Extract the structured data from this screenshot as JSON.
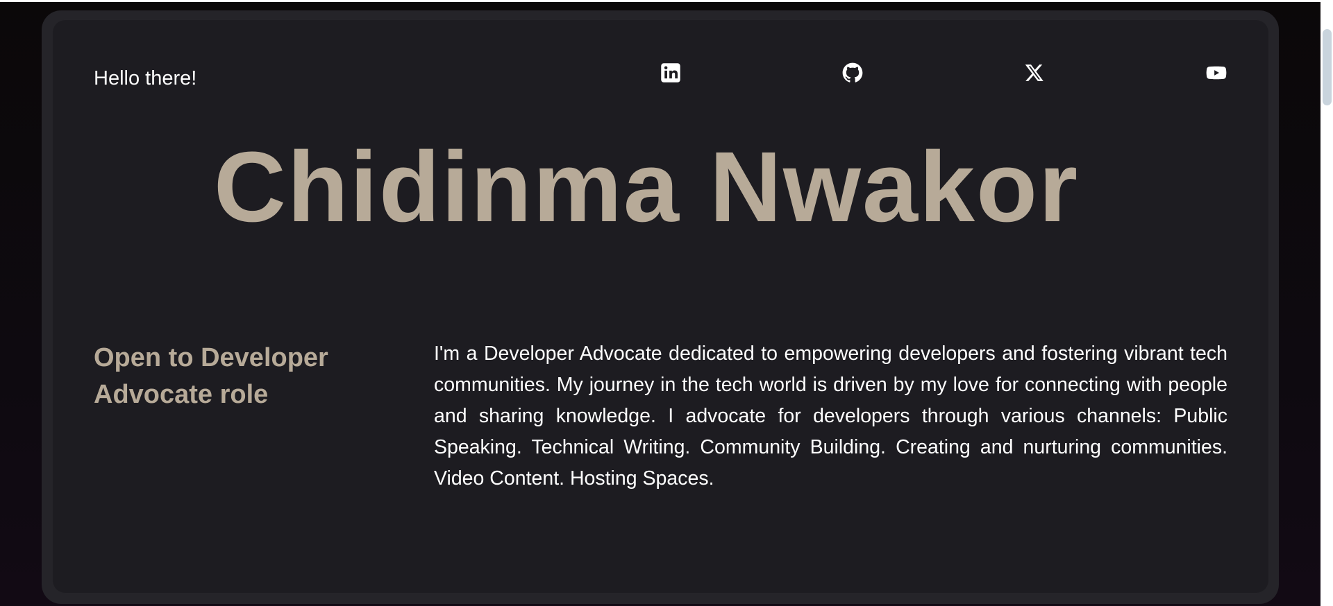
{
  "header": {
    "greeting": "Hello there!"
  },
  "social_links": [
    {
      "name": "linkedin",
      "icon": "linkedin-icon"
    },
    {
      "name": "github",
      "icon": "github-icon"
    },
    {
      "name": "x",
      "icon": "x-icon"
    },
    {
      "name": "youtube",
      "icon": "youtube-icon"
    }
  ],
  "hero": {
    "name": "Chidinma Nwakor"
  },
  "about": {
    "status": "Open to Developer Advocate role",
    "bio": "I'm a Developer Advocate dedicated to empowering developers and fostering vibrant tech communities. My journey in the tech world is driven by my love for connecting with people and sharing knowledge. I advocate for developers through various channels: Public Speaking. Technical Writing. Community Building. Creating and nurturing communities. Video Content. Hosting Spaces."
  },
  "colors": {
    "page_background": "#0e0a0f",
    "card_border": "#252429",
    "card_background": "#1d1c21",
    "accent": "#b7aa98",
    "text": "#ffffff"
  }
}
